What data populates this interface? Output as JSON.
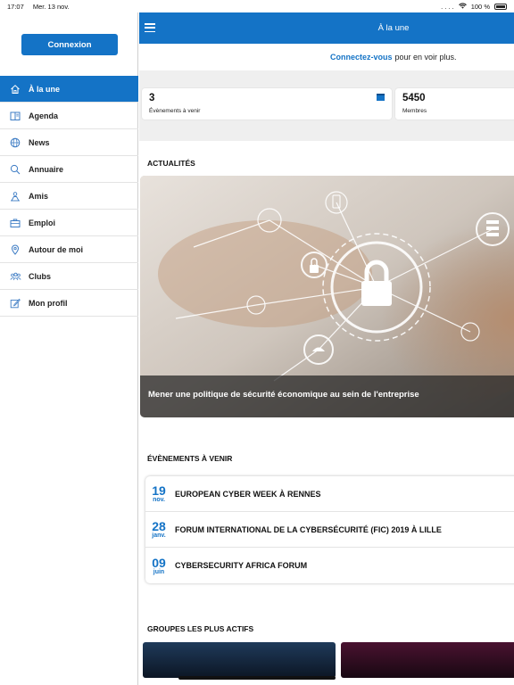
{
  "status_bar": {
    "time": "17:07",
    "date": "Mer. 13 nov.",
    "signal": ". . . .",
    "battery": "100 %"
  },
  "sidebar": {
    "login_label": "Connexion",
    "items": [
      {
        "label": "À la une",
        "icon": "home-icon",
        "active": true
      },
      {
        "label": "Agenda",
        "icon": "book-icon"
      },
      {
        "label": "News",
        "icon": "globe-icon"
      },
      {
        "label": "Annuaire",
        "icon": "search-icon"
      },
      {
        "label": "Amis",
        "icon": "people-icon"
      },
      {
        "label": "Emploi",
        "icon": "briefcase-icon"
      },
      {
        "label": "Autour de moi",
        "icon": "location-pin-icon"
      },
      {
        "label": "Clubs",
        "icon": "group-icon"
      },
      {
        "label": "Mon profil",
        "icon": "edit-icon"
      }
    ]
  },
  "header": {
    "title": "À la une"
  },
  "connect": {
    "link": "Connectez-vous",
    "text": "pour en voir plus."
  },
  "stats": [
    {
      "value": "3",
      "label": "Évènements à venir",
      "icon": "calendar-icon"
    },
    {
      "value": "5450",
      "label": "Membres"
    }
  ],
  "news": {
    "section_title": "ACTUALITÉS",
    "featured_caption": "Mener une politique de sécurité économique au sein de l'entreprise"
  },
  "events": {
    "section_title": "ÉVÈNEMENTS À VENIR",
    "items": [
      {
        "day": "19",
        "month": "nov.",
        "title": "EUROPEAN CYBER WEEK À RENNES"
      },
      {
        "day": "28",
        "month": "janv.",
        "title": "FORUM INTERNATIONAL DE LA CYBERSÉCURITÉ (FIC) 2019 À LILLE"
      },
      {
        "day": "09",
        "month": "juin",
        "title": "CYBERSECURITY AFRICA FORUM"
      }
    ]
  },
  "groups": {
    "section_title": "GROUPES LES PLUS ACTIFS"
  },
  "colors": {
    "accent": "#1473c6",
    "sidebar_active": "#1473c6",
    "stats_bg": "#efefef"
  }
}
